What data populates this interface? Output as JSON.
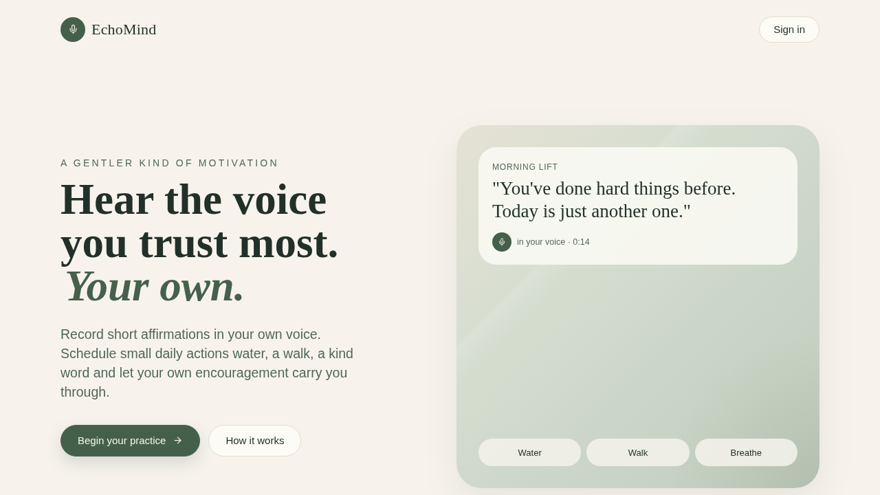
{
  "brand": {
    "name": "EchoMind"
  },
  "header": {
    "sign_in": "Sign in"
  },
  "hero": {
    "eyebrow": "A GENTLER KIND OF MOTIVATION",
    "title": "Hear the voice you trust most. *Your own.*",
    "description": "Record short affirmations in your own voice. Schedule small daily actions water, a walk, a kind word and let your own encouragement carry you through.",
    "actions": [
      {
        "label": "Begin your practice",
        "kind": "primary"
      },
      {
        "label": "How it works",
        "kind": "secondary"
      }
    ]
  },
  "preview": {
    "card": {
      "label": "MORNING LIFT",
      "quote": "\"You've done hard things before. Today is just another one.\"",
      "meta": "in your voice · 0:14"
    },
    "actions": [
      "Water",
      "Walk",
      "Breathe"
    ]
  }
}
